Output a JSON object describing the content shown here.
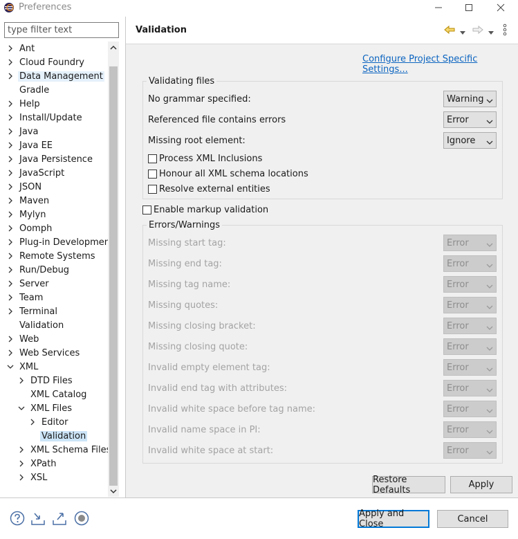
{
  "window": {
    "title": "Preferences"
  },
  "filter": {
    "placeholder": "type filter text"
  },
  "tree": [
    {
      "label": "Ant",
      "depth": 0,
      "exp": "c"
    },
    {
      "label": "Cloud Foundry",
      "depth": 0,
      "exp": "c"
    },
    {
      "label": "Data Management",
      "depth": 0,
      "exp": "c",
      "state": "hover"
    },
    {
      "label": "Gradle",
      "depth": 0,
      "exp": "n"
    },
    {
      "label": "Help",
      "depth": 0,
      "exp": "c"
    },
    {
      "label": "Install/Update",
      "depth": 0,
      "exp": "c"
    },
    {
      "label": "Java",
      "depth": 0,
      "exp": "c"
    },
    {
      "label": "Java EE",
      "depth": 0,
      "exp": "c"
    },
    {
      "label": "Java Persistence",
      "depth": 0,
      "exp": "c"
    },
    {
      "label": "JavaScript",
      "depth": 0,
      "exp": "c"
    },
    {
      "label": "JSON",
      "depth": 0,
      "exp": "c"
    },
    {
      "label": "Maven",
      "depth": 0,
      "exp": "c"
    },
    {
      "label": "Mylyn",
      "depth": 0,
      "exp": "c"
    },
    {
      "label": "Oomph",
      "depth": 0,
      "exp": "c"
    },
    {
      "label": "Plug-in Development",
      "depth": 0,
      "exp": "c"
    },
    {
      "label": "Remote Systems",
      "depth": 0,
      "exp": "c"
    },
    {
      "label": "Run/Debug",
      "depth": 0,
      "exp": "c"
    },
    {
      "label": "Server",
      "depth": 0,
      "exp": "c"
    },
    {
      "label": "Team",
      "depth": 0,
      "exp": "c"
    },
    {
      "label": "Terminal",
      "depth": 0,
      "exp": "c"
    },
    {
      "label": "Validation",
      "depth": 0,
      "exp": "n"
    },
    {
      "label": "Web",
      "depth": 0,
      "exp": "c"
    },
    {
      "label": "Web Services",
      "depth": 0,
      "exp": "c"
    },
    {
      "label": "XML",
      "depth": 0,
      "exp": "e"
    },
    {
      "label": "DTD Files",
      "depth": 1,
      "exp": "c"
    },
    {
      "label": "XML Catalog",
      "depth": 1,
      "exp": "n"
    },
    {
      "label": "XML Files",
      "depth": 1,
      "exp": "e"
    },
    {
      "label": "Editor",
      "depth": 2,
      "exp": "c"
    },
    {
      "label": "Validation",
      "depth": 2,
      "exp": "n",
      "state": "selected"
    },
    {
      "label": "XML Schema Files",
      "depth": 1,
      "exp": "c"
    },
    {
      "label": "XPath",
      "depth": 1,
      "exp": "c"
    },
    {
      "label": "XSL",
      "depth": 1,
      "exp": "c"
    }
  ],
  "page": {
    "title": "Validation",
    "config_link": "Configure Project Specific Settings...",
    "validating": {
      "title": "Validating files",
      "rows": [
        {
          "label": "No grammar specified:",
          "value": "Warning"
        },
        {
          "label": "Referenced file contains errors",
          "value": "Error"
        },
        {
          "label": "Missing root element:",
          "value": "Ignore"
        }
      ],
      "checkboxes": [
        {
          "label": "Process XML Inclusions",
          "checked": false
        },
        {
          "label": "Honour all XML schema locations",
          "checked": false
        },
        {
          "label": "Resolve external entities",
          "checked": false
        }
      ]
    },
    "markup": {
      "label": "Enable markup validation",
      "checked": false
    },
    "errors": {
      "title": "Errors/Warnings",
      "rows": [
        {
          "label": "Missing start tag:",
          "value": "Error"
        },
        {
          "label": "Missing end tag:",
          "value": "Error"
        },
        {
          "label": "Missing tag name:",
          "value": "Error"
        },
        {
          "label": "Missing quotes:",
          "value": "Error"
        },
        {
          "label": "Missing closing bracket:",
          "value": "Error"
        },
        {
          "label": "Missing closing quote:",
          "value": "Error"
        },
        {
          "label": "Invalid empty element tag:",
          "value": "Error"
        },
        {
          "label": "Invalid end tag with attributes:",
          "value": "Error"
        },
        {
          "label": "Invalid white space before tag name:",
          "value": "Error"
        },
        {
          "label": "Invalid name space in PI:",
          "value": "Error"
        },
        {
          "label": "Invalid white space at start:",
          "value": "Error"
        }
      ]
    },
    "restore_defaults": "Restore Defaults",
    "apply": "Apply"
  },
  "footer": {
    "apply_close": "Apply and Close",
    "cancel": "Cancel",
    "icons": [
      "help-icon",
      "import-icon",
      "export-icon",
      "record-icon"
    ]
  },
  "colors": {
    "selection": "#cce4f7",
    "hover": "#e5f1fb",
    "link": "#0b64c0",
    "panel": "#f0f0f0",
    "default_button_border": "#0078d7",
    "back_arrow": "#d4a017"
  }
}
